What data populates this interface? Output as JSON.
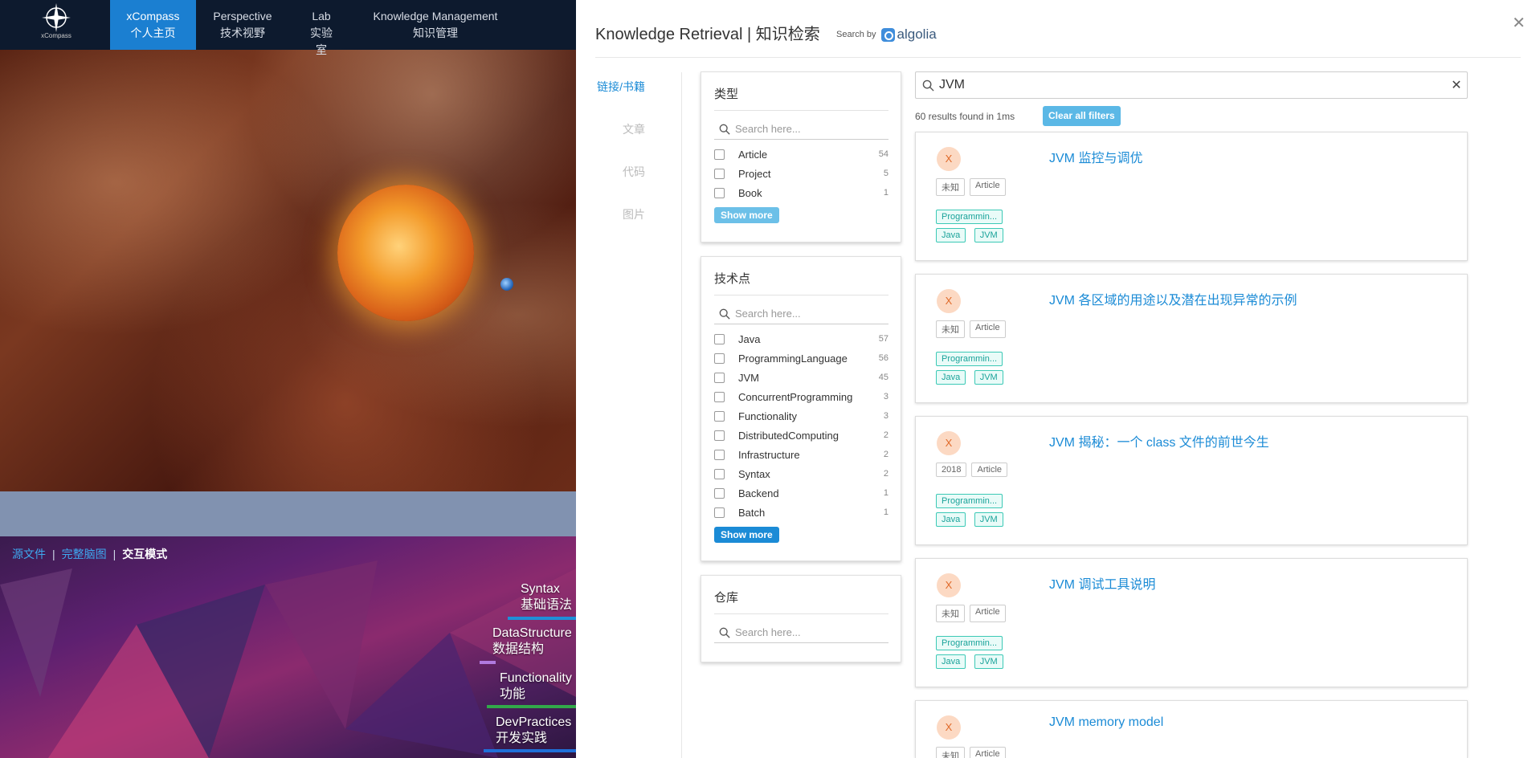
{
  "bg_app": {
    "logo_text": "xCompass",
    "nav": [
      {
        "label": "xCompass",
        "sub": "个人主页"
      },
      {
        "label": "Perspective",
        "sub": "技术视野"
      },
      {
        "label": "Lab",
        "sub": "实验室"
      },
      {
        "label": "Knowledge Management",
        "sub": "知识管理"
      }
    ],
    "breadcrumbs": {
      "source": "源文件",
      "full_map": "完整脑图",
      "sep": "|",
      "current": "交互模式"
    },
    "mindmap_nodes": [
      {
        "en": "Syntax",
        "zh": "基础语法"
      },
      {
        "en": "DataStructure",
        "zh": "数据结构"
      },
      {
        "en": "Functionality",
        "zh": "功能"
      },
      {
        "en": "DevPractices",
        "zh": "开发实践"
      }
    ]
  },
  "panel": {
    "title": "Knowledge Retrieval | 知识检索",
    "search_by": "Search by",
    "algolia": "algolia",
    "close_icon": "close-icon",
    "side_tabs": [
      "链接/书籍",
      "文章",
      "代码",
      "图片"
    ],
    "search": {
      "value": "JVM",
      "placeholder": "Search here..."
    },
    "stats": "60 results found in 1ms",
    "clear_filters": "Clear all filters",
    "accent_color": "#1b8bd6",
    "facets": [
      {
        "title": "类型",
        "placeholder": "Search here...",
        "items": [
          {
            "label": "Article",
            "count": "54"
          },
          {
            "label": "Project",
            "count": "5"
          },
          {
            "label": "Book",
            "count": "1"
          }
        ],
        "show_more": "Show more",
        "show_more_color": "#6cc0e8"
      },
      {
        "title": "技术点",
        "placeholder": "Search here...",
        "items": [
          {
            "label": "Java",
            "count": "57"
          },
          {
            "label": "ProgrammingLanguage",
            "count": "56"
          },
          {
            "label": "JVM",
            "count": "45"
          },
          {
            "label": "ConcurrentProgramming",
            "count": "3"
          },
          {
            "label": "Functionality",
            "count": "3"
          },
          {
            "label": "DistributedComputing",
            "count": "2"
          },
          {
            "label": "Infrastructure",
            "count": "2"
          },
          {
            "label": "Syntax",
            "count": "2"
          },
          {
            "label": "Backend",
            "count": "1"
          },
          {
            "label": "Batch",
            "count": "1"
          }
        ],
        "show_more": "Show more",
        "show_more_color": "#1b8bd6"
      },
      {
        "title": "仓库",
        "placeholder": "Search here...",
        "items": []
      }
    ],
    "hits": [
      {
        "avatar": "X",
        "title": "JVM 监控与调优",
        "year": "未知",
        "type": "Article",
        "tags": [
          "Programmin...",
          "Java",
          "JVM"
        ]
      },
      {
        "avatar": "X",
        "title": "JVM 各区域的用途以及潜在出现异常的示例",
        "year": "未知",
        "type": "Article",
        "tags": [
          "Programmin...",
          "Java",
          "JVM"
        ]
      },
      {
        "avatar": "X",
        "title": "JVM 揭秘：一个 class 文件的前世今生",
        "year": "2018",
        "type": "Article",
        "tags": [
          "Programmin...",
          "Java",
          "JVM"
        ]
      },
      {
        "avatar": "X",
        "title": "JVM 调试工具说明",
        "year": "未知",
        "type": "Article",
        "tags": [
          "Programmin...",
          "Java",
          "JVM"
        ]
      },
      {
        "avatar": "X",
        "title": "JVM memory model",
        "year": "未知",
        "type": "Article",
        "tags": []
      }
    ]
  }
}
